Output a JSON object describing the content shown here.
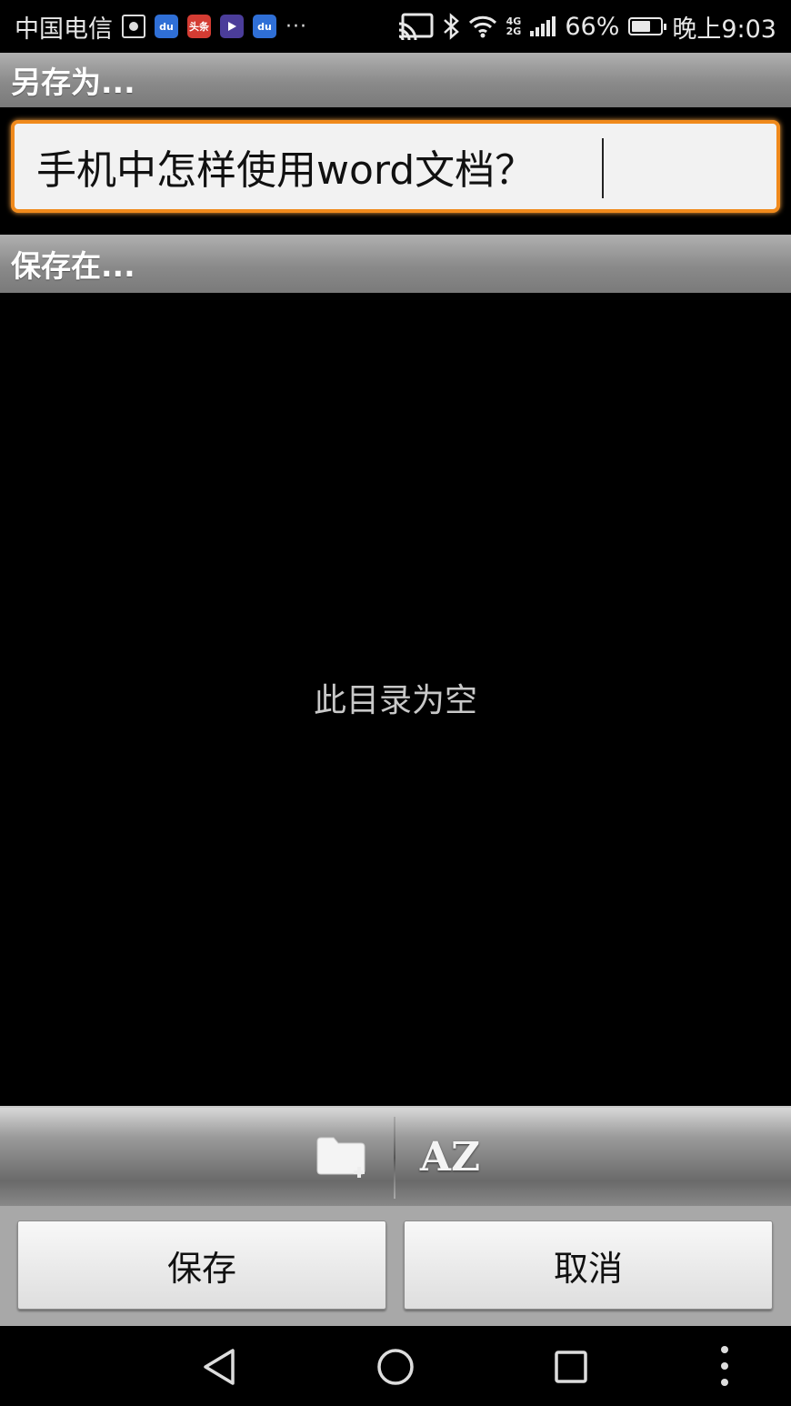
{
  "status_bar": {
    "carrier": "中国电信",
    "notification_icons": [
      {
        "name": "screen-record-icon"
      },
      {
        "name": "baidu-icon",
        "label": "du"
      },
      {
        "name": "toutiao-icon",
        "label": "头条"
      },
      {
        "name": "video-player-icon"
      },
      {
        "name": "baidu-map-icon",
        "label": "du"
      }
    ],
    "more_notifications": "···",
    "network_top": "4G",
    "network_bottom": "2G",
    "battery_percent": "66%",
    "battery_level": 0.66,
    "time": "晚上9:03"
  },
  "dialog": {
    "save_as_header": "另存为...",
    "filename_value": "手机中怎样使用word文档？",
    "save_in_header": "保存在...",
    "empty_message": "此目录为空",
    "sort_label": "AZ",
    "save_button": "保存",
    "cancel_button": "取消"
  },
  "colors": {
    "accent_orange": "#f08a1c",
    "header_gray": "#8a8a8a"
  }
}
